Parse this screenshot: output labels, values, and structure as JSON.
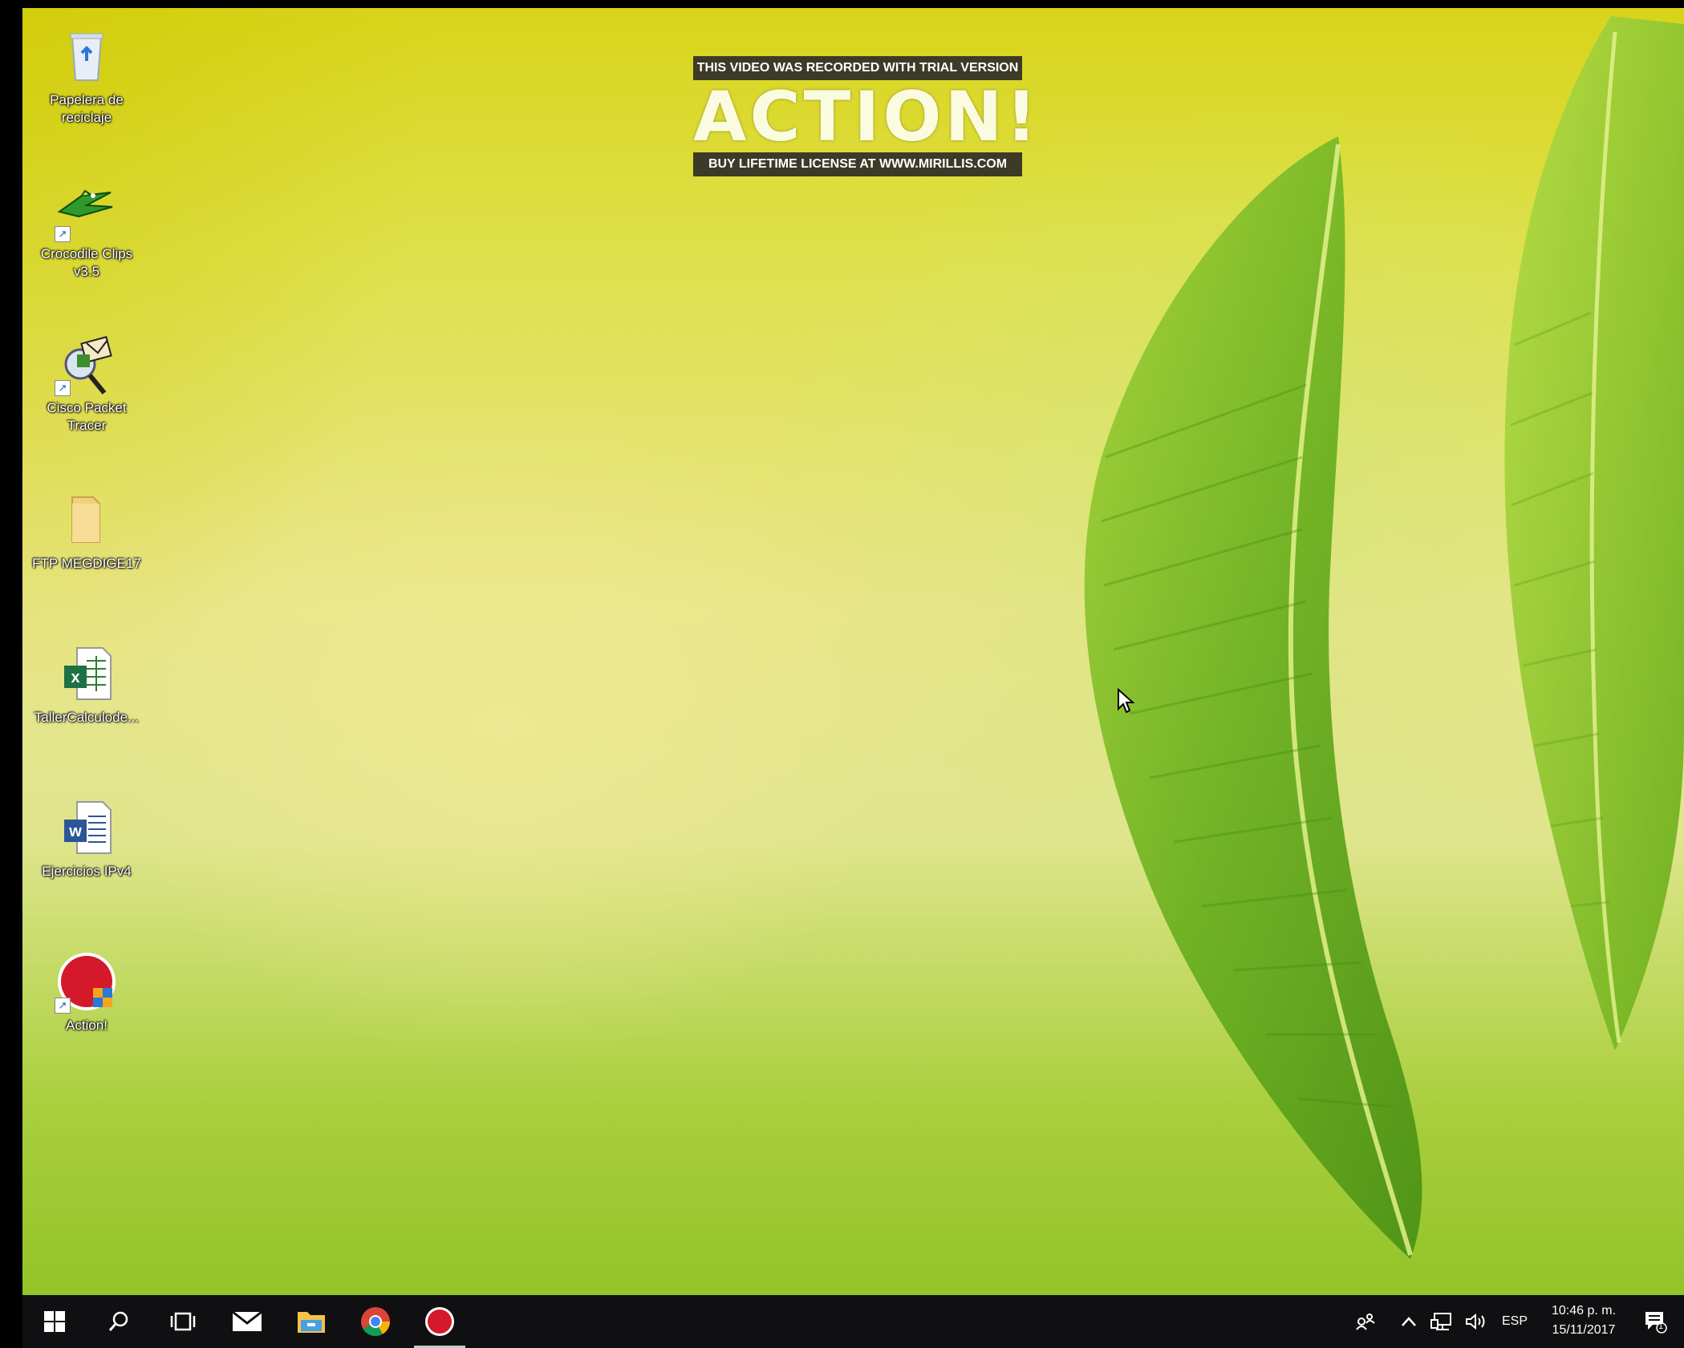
{
  "desktop": {
    "icons": [
      {
        "label": "Papelera de reciclaje",
        "icon": "recycle-bin-icon"
      },
      {
        "label": "Crocodile Clips v3.5",
        "icon": "crocodile-clips-icon"
      },
      {
        "label": "Cisco Packet Tracer",
        "icon": "cisco-packet-tracer-icon"
      },
      {
        "label": "FTP MEGDIGE17",
        "icon": "folder-icon"
      },
      {
        "label": "TallerCalculode...",
        "icon": "excel-file-icon"
      },
      {
        "label": "Ejercicios IPv4",
        "icon": "word-file-icon"
      },
      {
        "label": "Action!",
        "icon": "action-recorder-icon"
      }
    ]
  },
  "watermark": {
    "top_text": "THIS VIDEO WAS RECORDED WITH TRIAL VERSION",
    "logo_text": "ACTION!",
    "bottom_text": "BUY LIFETIME LICENSE AT WWW.MIRILLIS.COM"
  },
  "taskbar": {
    "pinned": [
      {
        "icon": "windows-start-icon"
      },
      {
        "icon": "search-icon"
      },
      {
        "icon": "task-view-icon"
      },
      {
        "icon": "mail-icon"
      },
      {
        "icon": "file-explorer-icon"
      },
      {
        "icon": "chrome-icon"
      },
      {
        "icon": "action-recorder-icon",
        "active": true
      }
    ],
    "tray": {
      "language": "ESP",
      "time": "10:46 p. m.",
      "date": "15/11/2017",
      "notification_count": "1"
    }
  },
  "colors": {
    "taskbar": "#101012",
    "wallpaper_top": "#d8d41a",
    "wallpaper_bottom": "#8cc021",
    "leaf": "#5fa51a"
  }
}
